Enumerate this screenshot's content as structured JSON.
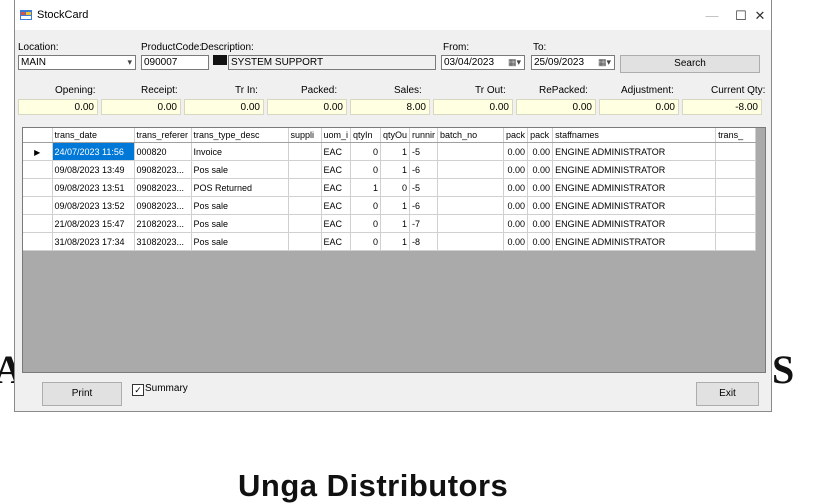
{
  "window": {
    "title": "StockCard",
    "minimize": "—",
    "maximize": "☐",
    "close": "✕"
  },
  "background": {
    "left_fragment": "A",
    "right_fragment": "S",
    "bottom_text": "Unga Distributors"
  },
  "filters": {
    "location_label": "Location:",
    "location_value": "MAIN",
    "productcode_label": "ProductCode:",
    "productcode_value": "090007",
    "description_label": "Description:",
    "description_value": "SYSTEM SUPPORT",
    "from_label": "From:",
    "from_value": "03/04/2023",
    "to_label": "To:",
    "to_value": "25/09/2023",
    "search_label": "Search"
  },
  "summary": {
    "labels": [
      "Opening:",
      "Receipt:",
      "Tr In:",
      "Packed:",
      "Sales:",
      "Tr Out:",
      "RePacked:",
      "Adjustment:",
      "Current Qty:"
    ],
    "values": [
      "0.00",
      "0.00",
      "0.00",
      "0.00",
      "8.00",
      "0.00",
      "0.00",
      "0.00",
      "-8.00"
    ]
  },
  "grid": {
    "columns": [
      "trans_date",
      "trans_referer",
      "trans_type_desc",
      "suppli",
      "uom_i",
      "qtyIn",
      "qtyOu",
      "runnir",
      "batch_no",
      "pack",
      "pack",
      "staffnames",
      "trans_"
    ],
    "rows": [
      [
        "24/07/2023 11:56",
        "000820",
        "Invoice",
        "",
        "EAC",
        "0",
        "1",
        "-5",
        "",
        "0.00",
        "0.00",
        "ENGINE ADMINISTRATOR",
        ""
      ],
      [
        "09/08/2023 13:49",
        "09082023...",
        "Pos sale",
        "",
        "EAC",
        "0",
        "1",
        "-6",
        "",
        "0.00",
        "0.00",
        "ENGINE ADMINISTRATOR",
        ""
      ],
      [
        "09/08/2023 13:51",
        "09082023...",
        "POS Returned",
        "",
        "EAC",
        "1",
        "0",
        "-5",
        "",
        "0.00",
        "0.00",
        "ENGINE ADMINISTRATOR",
        ""
      ],
      [
        "09/08/2023 13:52",
        "09082023...",
        "Pos sale",
        "",
        "EAC",
        "0",
        "1",
        "-6",
        "",
        "0.00",
        "0.00",
        "ENGINE ADMINISTRATOR",
        ""
      ],
      [
        "21/08/2023 15:47",
        "21082023...",
        "Pos sale",
        "",
        "EAC",
        "0",
        "1",
        "-7",
        "",
        "0.00",
        "0.00",
        "ENGINE ADMINISTRATOR",
        ""
      ],
      [
        "31/08/2023 17:34",
        "31082023...",
        "Pos sale",
        "",
        "EAC",
        "0",
        "1",
        "-8",
        "",
        "0.00",
        "0.00",
        "ENGINE ADMINISTRATOR",
        ""
      ]
    ],
    "selected_row": 0
  },
  "footer": {
    "print_label": "Print",
    "summary_label": "Summary",
    "summary_checked": true,
    "exit_label": "Exit"
  }
}
